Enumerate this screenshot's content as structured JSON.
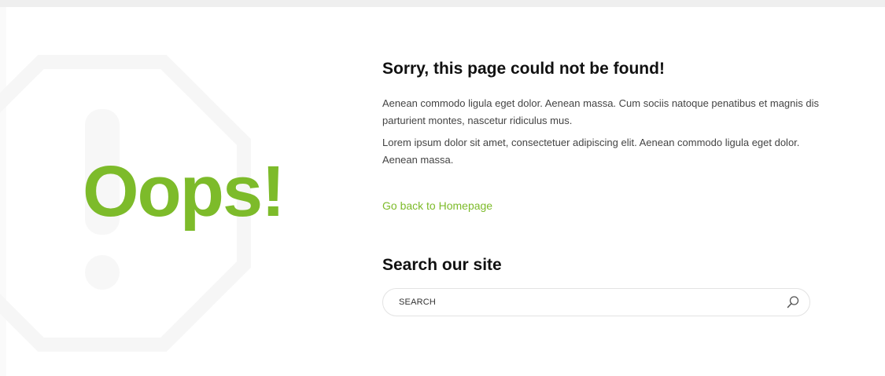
{
  "hero": {
    "oops_text": "Oops!"
  },
  "error": {
    "title": "Sorry, this page could not be found!",
    "paragraph_1": "Aenean commodo ligula eget dolor. Aenean massa. Cum sociis natoque penatibus et magnis dis parturient montes, nascetur ridiculus mus.",
    "paragraph_2": "Lorem ipsum dolor sit amet, consectetuer adipiscing elit. Aenean commodo ligula eget dolor. Aenean massa.",
    "home_link": "Go back to Homepage"
  },
  "search": {
    "title": "Search our site",
    "placeholder": "SEARCH",
    "value": "",
    "icon": "search-icon"
  },
  "colors": {
    "accent": "#7dbb2a",
    "heading": "#111111",
    "body_text": "#444444",
    "background": "#ffffff"
  }
}
